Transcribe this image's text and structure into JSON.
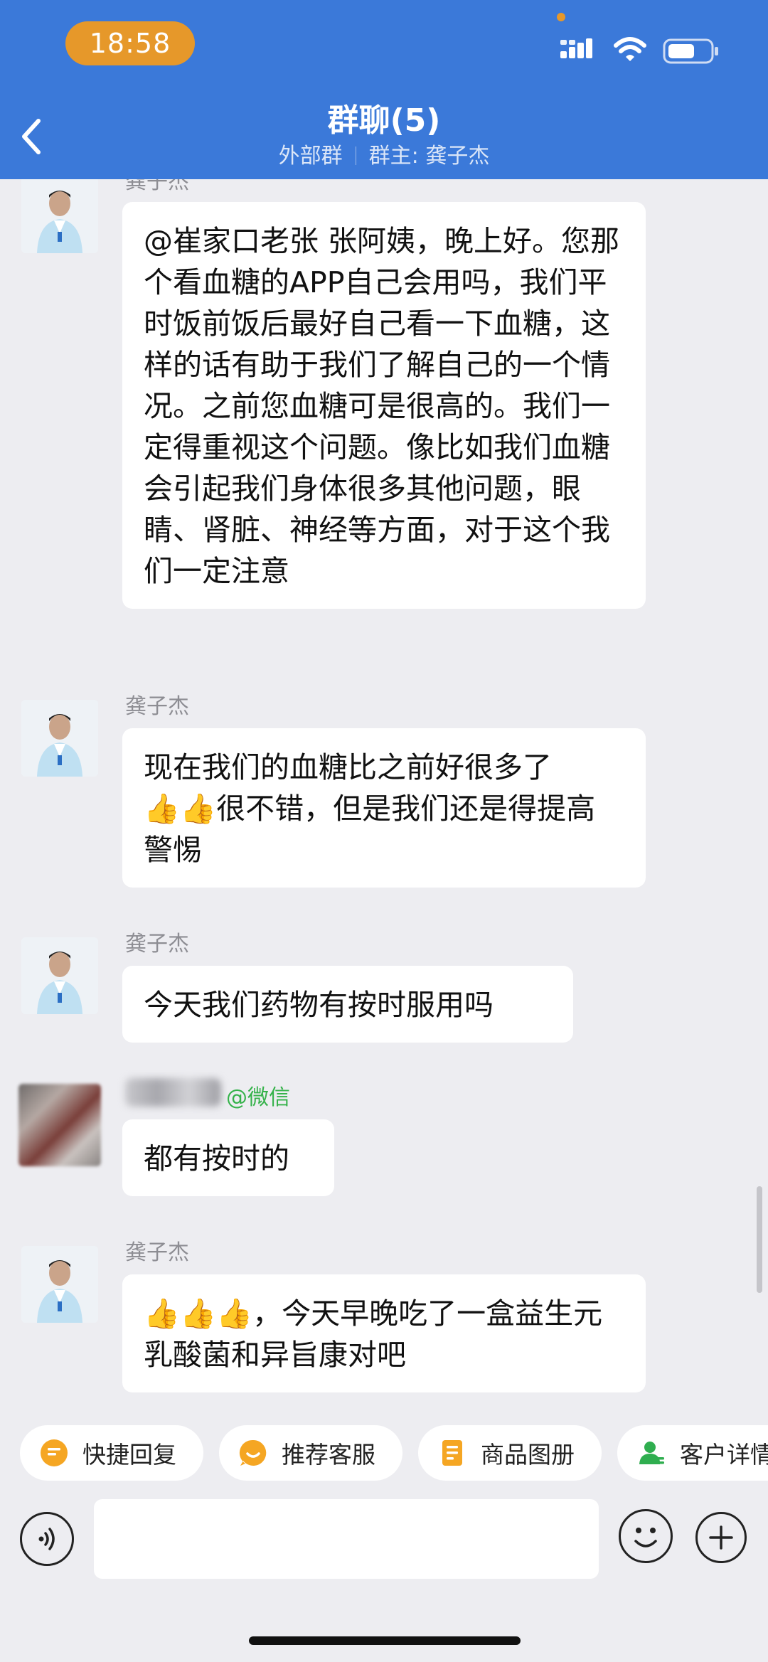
{
  "status_bar": {
    "time": "18:58",
    "icons": [
      "signal-icon",
      "wifi-icon",
      "battery-icon"
    ]
  },
  "header": {
    "title": "群聊(5)",
    "subtitle_left": "外部群",
    "subtitle_right": "群主: 龚子杰",
    "back_icon": "chevron-left-icon"
  },
  "messages": [
    {
      "sender": "龚子杰",
      "text": "@崔家口老张 张阿姨，晚上好。您那个看血糖的APP自己会用吗，我们平时饭前饭后最好自己看一下血糖，这样的话有助于我们了解自己的一个情况。之前您血糖可是很高的。我们一定得重视这个问题。像比如我们血糖会引起我们身体很多其他问题，眼睛、肾脏、神经等方面，对于这个我们一定注意"
    },
    {
      "sender": "龚子杰",
      "text_prefix": "现在我们的血糖比之前好很多了",
      "text_suffix": "很不错，但是我们还是得提高警惕"
    },
    {
      "sender": "龚子杰",
      "text": "今天我们药物有按时服用吗"
    },
    {
      "sender": "",
      "sender_tag": "@微信",
      "text": "都有按时的"
    },
    {
      "sender": "龚子杰",
      "text_suffix": "，今天早晚吃了一盒益生元乳酸菌和异旨康对吧"
    }
  ],
  "quick_actions": [
    {
      "label": "快捷回复",
      "icon": "quick-reply-icon"
    },
    {
      "label": "推荐客服",
      "icon": "recommend-service-icon"
    },
    {
      "label": "商品图册",
      "icon": "product-album-icon"
    },
    {
      "label": "客户详情",
      "icon": "customer-detail-icon"
    }
  ],
  "input_bar": {
    "placeholder": "",
    "icons": [
      "voice-icon",
      "emoji-icon",
      "plus-icon"
    ]
  },
  "colors": {
    "header": "#3b79d9",
    "time_pill": "#e6982a",
    "background": "#ededf1",
    "wechat_tag": "#35b24a"
  }
}
